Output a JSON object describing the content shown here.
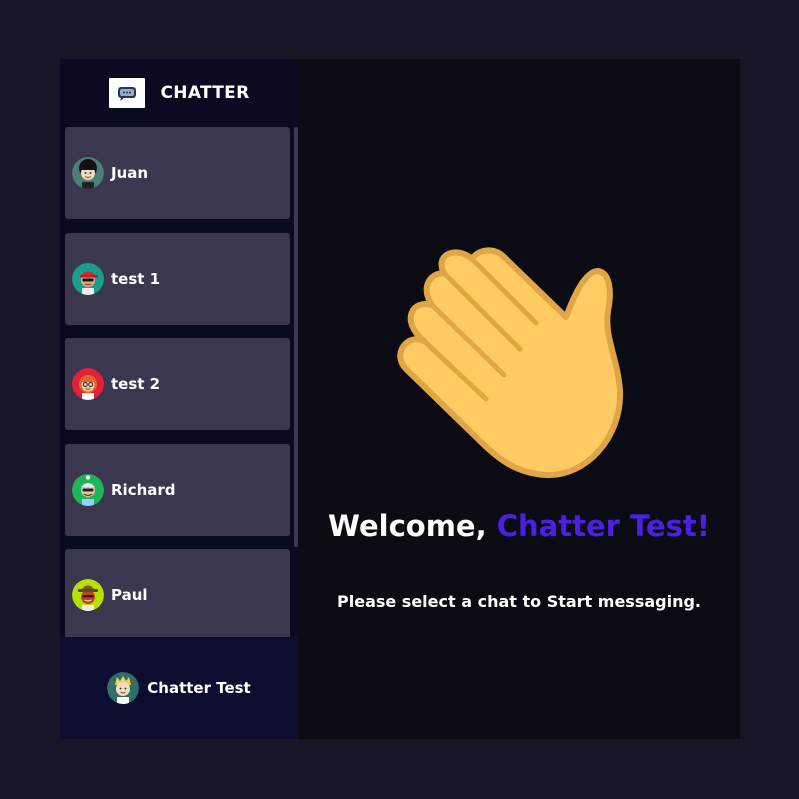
{
  "app": {
    "name": "CHATTER",
    "logo_icon": "chat-bubble-icon"
  },
  "contacts": [
    {
      "name": "Juan",
      "avatar": "avatar-afro-icon"
    },
    {
      "name": "test 1",
      "avatar": "avatar-red-cap-icon"
    },
    {
      "name": "test 2",
      "avatar": "avatar-redhead-glasses-icon"
    },
    {
      "name": "Richard",
      "avatar": "avatar-green-sunglasses-icon"
    },
    {
      "name": "Paul",
      "avatar": "avatar-hat-icon"
    }
  ],
  "current_user": {
    "name": "Chatter Test",
    "avatar": "avatar-blonde-icon"
  },
  "main": {
    "icon": "waving-hand-icon",
    "welcome_prefix": "Welcome, ",
    "welcome_user": "Chatter Test!",
    "prompt": "Please select a chat to Start messaging."
  },
  "colors": {
    "page_bg": "#161627",
    "sidebar_bg": "#0a0a20",
    "contact_bg": "#3a374e",
    "user_bar_bg": "#0d0d30",
    "main_bg": "#0b0b14",
    "accent": "#4a1fe6"
  }
}
